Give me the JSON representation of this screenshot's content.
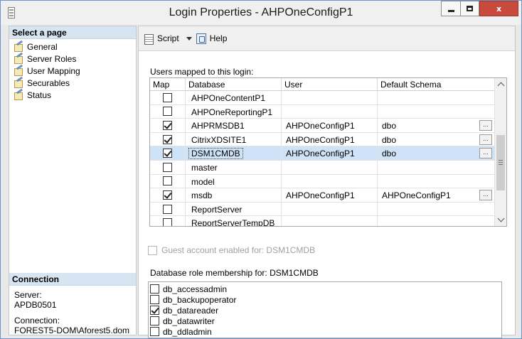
{
  "window": {
    "title": "Login Properties - AHPOneConfigP1",
    "controls": {
      "minimize": "minimize",
      "maximize": "maximize",
      "close": "x"
    }
  },
  "left_pane": {
    "select_page_header": "Select a page",
    "pages": [
      {
        "label": "General",
        "icon": "page-wrench-icon"
      },
      {
        "label": "Server Roles",
        "icon": "page-wrench-icon"
      },
      {
        "label": "User Mapping",
        "icon": "page-wrench-icon"
      },
      {
        "label": "Securables",
        "icon": "page-wrench-icon"
      },
      {
        "label": "Status",
        "icon": "page-wrench-icon"
      }
    ],
    "connection": {
      "header": "Connection",
      "server_label": "Server:",
      "server_value": "APDB0501",
      "connection_label": "Connection:",
      "connection_value": "FOREST5-DOM\\Aforest5.dom"
    }
  },
  "toolbar": {
    "script_label": "Script",
    "help_label": "Help"
  },
  "user_mapping": {
    "users_label": "Users mapped to this login:",
    "columns": [
      "Map",
      "Database",
      "User",
      "Default Schema"
    ],
    "rows": [
      {
        "map": false,
        "database": "AHPOneContentP1",
        "user": "",
        "schema": "",
        "has_browse": false,
        "selected": false
      },
      {
        "map": false,
        "database": "AHPOneReportingP1",
        "user": "",
        "schema": "",
        "has_browse": false,
        "selected": false
      },
      {
        "map": true,
        "database": "AHPRMSDB1",
        "user": "AHPOneConfigP1",
        "schema": "dbo",
        "has_browse": true,
        "selected": false
      },
      {
        "map": true,
        "database": "CitrixXDSITE1",
        "user": "AHPOneConfigP1",
        "schema": "dbo",
        "has_browse": true,
        "selected": false
      },
      {
        "map": true,
        "database": "DSM1CMDB",
        "user": "AHPOneConfigP1",
        "schema": "dbo",
        "has_browse": true,
        "selected": true
      },
      {
        "map": false,
        "database": "master",
        "user": "",
        "schema": "",
        "has_browse": false,
        "selected": false
      },
      {
        "map": false,
        "database": "model",
        "user": "",
        "schema": "",
        "has_browse": false,
        "selected": false
      },
      {
        "map": true,
        "database": "msdb",
        "user": "AHPOneConfigP1",
        "schema": "AHPOneConfigP1",
        "has_browse": true,
        "selected": false
      },
      {
        "map": false,
        "database": "ReportServer",
        "user": "",
        "schema": "",
        "has_browse": false,
        "selected": false
      },
      {
        "map": false,
        "database": "ReportServerTempDB",
        "user": "",
        "schema": "",
        "has_browse": false,
        "selected": false
      }
    ],
    "browse_button_label": "...",
    "guest_account_label": "Guest account enabled for: DSM1CMDB",
    "guest_account_enabled": false
  },
  "role_membership": {
    "label": "Database role membership for: DSM1CMDB",
    "roles": [
      {
        "name": "db_accessadmin",
        "checked": false
      },
      {
        "name": "db_backupoperator",
        "checked": false
      },
      {
        "name": "db_datareader",
        "checked": true
      },
      {
        "name": "db_datawriter",
        "checked": false
      },
      {
        "name": "db_ddladmin",
        "checked": false
      }
    ]
  },
  "colors": {
    "title_bar": "#f0f0f0",
    "close_button": "#c74a3c",
    "section_header": "#d7e4f2",
    "selected_row": "#cfe3f8"
  }
}
